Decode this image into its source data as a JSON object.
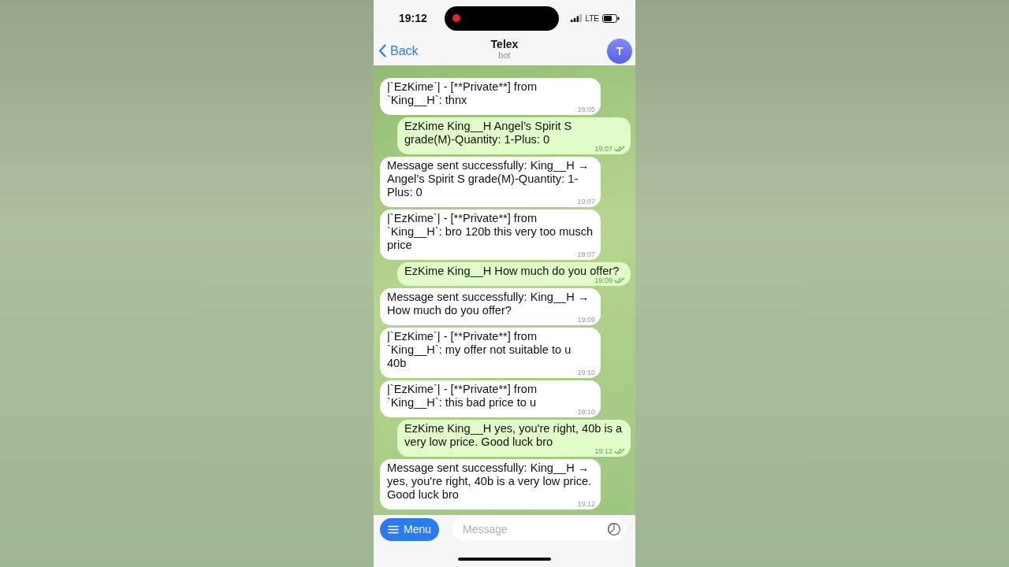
{
  "status_bar": {
    "time": "19:12",
    "recording": true,
    "network": "LTE"
  },
  "header": {
    "back": "Back",
    "title": "Telex",
    "subtitle": "bot",
    "avatar_letter": "T"
  },
  "messages": [
    {
      "kind": "incoming",
      "text": "|`EzKime`| - [**Private**] from `King__H`: thnx",
      "time": "19:05"
    },
    {
      "kind": "outgoing",
      "text": "EzKime King__H Angel’s Spirit S grade(M)-Quantity: 1-Plus: 0",
      "time": "19:07",
      "read": true
    },
    {
      "kind": "incoming",
      "text": "Message sent successfully: King__H → Angel’s Spirit S grade(M)-Quantity: 1-Plus: 0",
      "time": "19:07"
    },
    {
      "kind": "incoming",
      "text": "|`EzKime`| - [**Private**] from `King__H`: bro 120b this very too musch price",
      "time": "19:07"
    },
    {
      "kind": "outgoing",
      "text": "EzKime King__H How much do you offer?",
      "time": "19:09",
      "read": true
    },
    {
      "kind": "incoming",
      "text": "Message sent successfully: King__H → How much do you offer?",
      "time": "19:09"
    },
    {
      "kind": "incoming",
      "text": "|`EzKime`| - [**Private**] from `King__H`: my offer not suitable to u  40b",
      "time": "19:10"
    },
    {
      "kind": "incoming",
      "text": "|`EzKime`| - [**Private**] from `King__H`: this bad price to u",
      "time": "19:10"
    },
    {
      "kind": "outgoing",
      "text": "EzKime King__H yes, you're right, 40b is a very low price. Good luck bro",
      "time": "19:12",
      "read": true
    },
    {
      "kind": "incoming",
      "text": "Message sent successfully: King__H → yes, you're right, 40b is a very low price. Good luck bro",
      "time": "19:12"
    }
  ],
  "composer": {
    "menu": "Menu",
    "placeholder": "Message"
  }
}
